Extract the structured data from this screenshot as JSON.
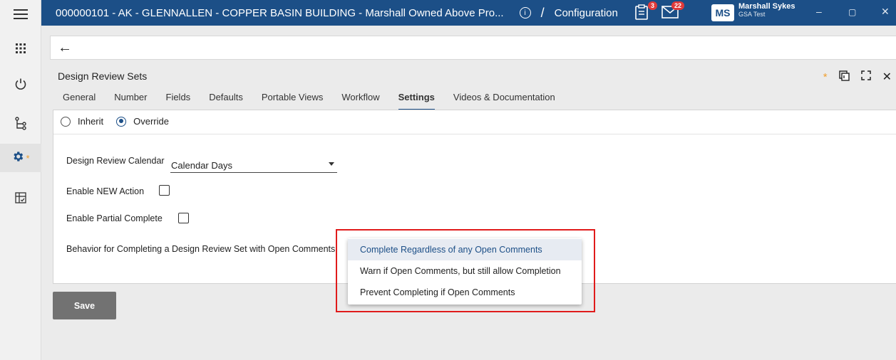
{
  "window": {
    "title": "000000101 - AK - GLENNALLEN - COPPER BASIN BUILDING - Marshall Owned Above Pro...",
    "separator": "/",
    "section": "Configuration",
    "info_glyph": "i",
    "tasks_badge": "3",
    "mail_badge": "22",
    "user_initials": "MS",
    "user_name": "Marshall Sykes",
    "user_org": "GSA Test",
    "minimize_glyph": "–",
    "maximize_glyph": "▢",
    "close_glyph": "✕"
  },
  "rail": {
    "icons": [
      "menu-icon",
      "apps-grid-icon",
      "power-icon",
      "hierarchy-icon",
      "gear-icon",
      "checklist-icon"
    ],
    "active": "gear-icon",
    "active_marker": "*"
  },
  "back_glyph": "←",
  "panel": {
    "title": "Design Review Sets",
    "modified_marker": "*",
    "tabs": [
      "General",
      "Number",
      "Fields",
      "Defaults",
      "Portable Views",
      "Workflow",
      "Settings",
      "Videos & Documentation"
    ],
    "active_tab": "Settings",
    "close_glyph": "✕"
  },
  "settings": {
    "radio_inherit": "Inherit",
    "radio_override": "Override",
    "selected_radio": "Override",
    "calendar_label": "Design Review Calendar",
    "calendar_value": "Calendar Days",
    "enable_new_action_label": "Enable NEW Action",
    "enable_new_action_checked": false,
    "enable_partial_label": "Enable Partial Complete",
    "enable_partial_checked": false,
    "behavior_label": "Behavior for Completing a Design Review Set with Open Comments"
  },
  "dropdown": {
    "options": [
      "Complete Regardless of any Open Comments",
      "Warn if Open Comments, but still allow Completion",
      "Prevent Completing if Open Comments"
    ],
    "highlighted": 0
  },
  "save_label": "Save",
  "colors": {
    "topbar": "#1c4f87",
    "highlight_box": "#e01b1b",
    "badge": "#e03a3a",
    "modified": "#f0a030"
  }
}
